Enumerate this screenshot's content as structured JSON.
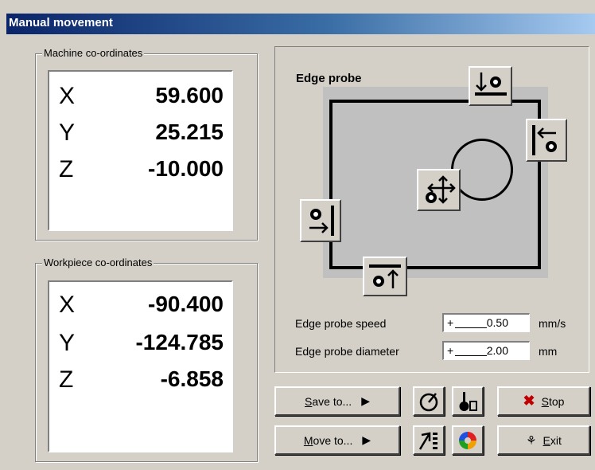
{
  "window": {
    "title": "Manual movement"
  },
  "machine": {
    "label": "Machine co-ordinates",
    "rows": [
      {
        "axis": "X",
        "value": "59.600"
      },
      {
        "axis": "Y",
        "value": "25.215"
      },
      {
        "axis": "Z",
        "value": "-10.000"
      }
    ]
  },
  "workpiece": {
    "label": "Workpiece co-ordinates",
    "rows": [
      {
        "axis": "X",
        "value": "-90.400"
      },
      {
        "axis": "Y",
        "value": "-124.785"
      },
      {
        "axis": "Z",
        "value": "-6.858"
      }
    ]
  },
  "probe": {
    "title": "Edge probe",
    "speed_label": "Edge probe speed",
    "speed_sign": "+",
    "speed_value": "0.50",
    "speed_unit": "mm/s",
    "diameter_label": "Edge probe diameter",
    "diameter_sign": "+",
    "diameter_value": "2.00",
    "diameter_unit": "mm"
  },
  "buttons": {
    "save_first": "S",
    "save_rest": "ave to...",
    "move_first": "M",
    "move_rest": "ove to...",
    "stop_first": "S",
    "stop_rest": "top",
    "exit_first": "E",
    "exit_rest": "xit"
  },
  "icons": {
    "probe_top": "probe-down-icon",
    "probe_right": "probe-left-icon",
    "probe_left": "probe-right-icon",
    "probe_bottom": "probe-up-icon",
    "probe_center": "probe-center-icon",
    "gauge": "gauge-icon",
    "tool": "tool-length-icon",
    "list": "list-icon",
    "colors": "color-wheel-icon",
    "stop": "red-x-icon",
    "exit": "exit-icon"
  }
}
